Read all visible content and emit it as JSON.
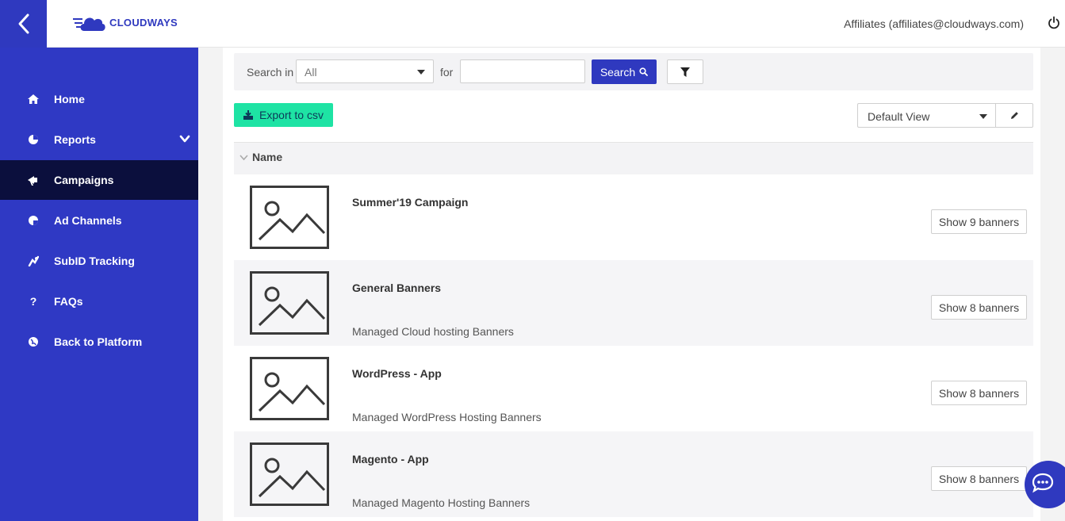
{
  "brand": {
    "name": "CLOUDWAYS",
    "color": "#2f39bf"
  },
  "header": {
    "user": "Affiliates (affiliates@cloudways.com)",
    "back_icon": "chevron-left-icon",
    "power_icon": "power-icon"
  },
  "sidebar": {
    "items": [
      {
        "label": "Home",
        "icon": "home-icon"
      },
      {
        "label": "Reports",
        "icon": "pie-chart-icon"
      },
      {
        "label": "Campaigns",
        "icon": "campaign-icon",
        "active": true
      },
      {
        "label": "Ad Channels",
        "icon": "pie-chart-icon"
      },
      {
        "label": "SubID Tracking",
        "icon": "tracking-icon"
      },
      {
        "label": "FAQs",
        "icon": "question-icon"
      },
      {
        "label": "Back to Platform",
        "icon": "globe-icon"
      }
    ]
  },
  "search": {
    "search_in_label": "Search in",
    "scope_value": "All",
    "for_label": "for",
    "query_value": "",
    "button_label": "Search"
  },
  "toolbar": {
    "export_label": "Export to csv",
    "view_value": "Default View"
  },
  "table": {
    "column_name": "Name",
    "rows": [
      {
        "title": "Summer'19 Campaign",
        "description": "",
        "button": "Show 9 banners"
      },
      {
        "title": "General Banners",
        "description": "Managed Cloud hosting Banners",
        "button": "Show 8 banners"
      },
      {
        "title": "WordPress - App",
        "description": "Managed WordPress Hosting Banners",
        "button": "Show 8 banners"
      },
      {
        "title": "Magento - App",
        "description": "Managed Magento Hosting Banners",
        "button": "Show 8 banners"
      }
    ]
  },
  "colors": {
    "sidebar": "#2f39c4",
    "active": "#0b0f3d",
    "export": "#1ee3a4"
  }
}
